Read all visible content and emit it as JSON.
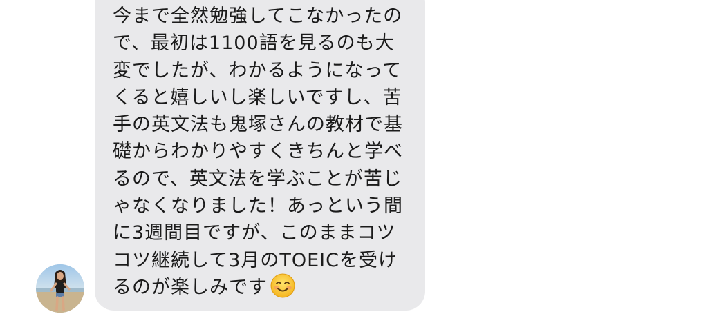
{
  "conversation": {
    "message": {
      "lines": [
        "今まで全然勉強してこなかったの",
        "で、最初は1100語を見るのも大",
        "変でしたが、わかるようになって",
        "くると嬉しいし楽しいですし、苦",
        "手の英文法も鬼塚さんの教材で基",
        "礎からわかりやすくきちんと学べ",
        "るので、英文法を学ぶことが苦じ",
        "ゃなくなりました！あっという間",
        "に3週間目ですが、このままコツ",
        "コツ継続して3月のTOEICを受け",
        "るのが楽しみです"
      ],
      "emoji": "smiling-face-emoji"
    },
    "sender": {
      "avatar": "user-avatar-photo"
    }
  },
  "colors": {
    "bubble_background": "#e9e9eb",
    "text": "#1b1b1b",
    "page_background": "#ffffff"
  }
}
